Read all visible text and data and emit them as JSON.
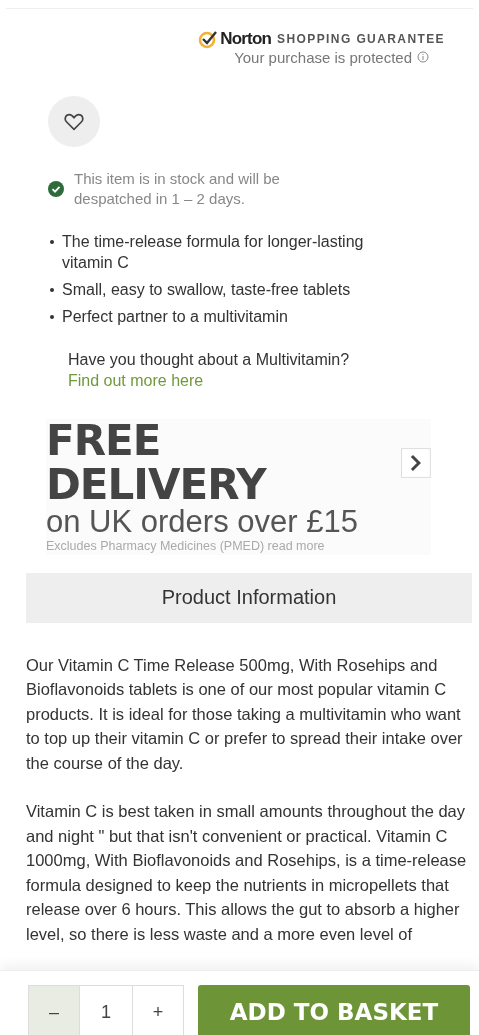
{
  "guarantee": {
    "brand": "Norton",
    "title": "SHOPPING GUARANTEE",
    "subtitle": "Your purchase is protected"
  },
  "stock": {
    "text": "This item is in stock and will be despatched in 1 – 2 days."
  },
  "features": [
    "The time-release formula for longer-lasting vitamin C",
    "Small, easy to swallow, taste-free tablets",
    "Perfect partner to a multivitamin"
  ],
  "promo": {
    "text": "Have you thought about a Multivitamin?",
    "link": "Find out more here"
  },
  "delivery": {
    "headline": "FREE DELIVERY",
    "subline": "on UK orders over £15",
    "note": "Excludes Pharmacy Medicines (PMED) read more"
  },
  "section": {
    "title": "Product Information"
  },
  "description": [
    "Our Vitamin C Time Release 500mg, With Rosehips and Bioflavonoids tablets is one of our most popular vitamin C products. It is ideal for those taking a multivitamin who want to top up their vitamin C or prefer to spread their intake over the course of the day.",
    "Vitamin C is best taken in small amounts throughout the day and night \" but that isn't convenient or practical. Vitamin C 1000mg, With Bioflavonoids and Rosehips, is a time-release formula designed to keep the nutrients in micropellets that release over 6 hours. This allows the gut to absorb a higher level, so there is less waste and a more even level of"
  ],
  "basket": {
    "decrease": "–",
    "quantity": "1",
    "increase": "+",
    "button": "ADD TO BASKET"
  }
}
